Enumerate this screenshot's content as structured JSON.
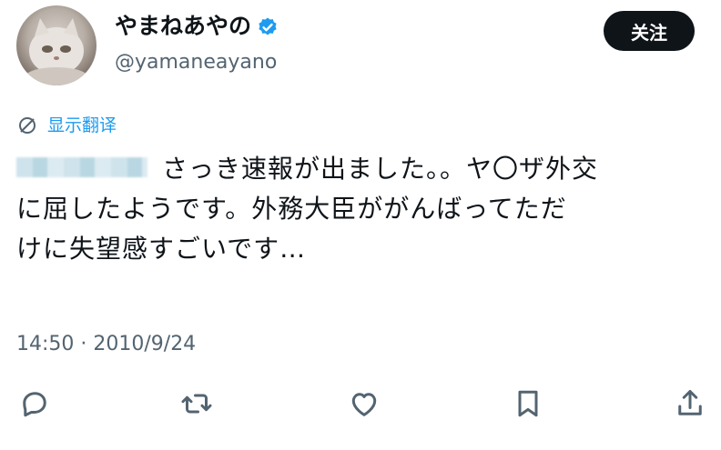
{
  "user": {
    "display_name": "やまねあやの",
    "handle": "@yamaneayano",
    "verified": true
  },
  "header": {
    "follow_label": "关注"
  },
  "translate": {
    "label": "显示翻译",
    "icon": "translate-globe-icon"
  },
  "tweet": {
    "lines": [
      "さっき速報が出ました。。ヤ〇ザ外交",
      "に屈したようです。外務大臣ががんばってただ",
      "けに失望感すごいです…"
    ],
    "timestamp": "14:50 · 2010/9/24"
  },
  "actions": [
    {
      "name": "reply",
      "icon": "reply-icon"
    },
    {
      "name": "retweet",
      "icon": "retweet-icon"
    },
    {
      "name": "like",
      "icon": "heart-icon"
    },
    {
      "name": "bookmark",
      "icon": "bookmark-icon"
    },
    {
      "name": "share",
      "icon": "share-icon"
    }
  ],
  "colors": {
    "accent": "#1d9bf0",
    "text": "#0f1419",
    "secondary": "#536471",
    "button_bg": "#0f1419"
  }
}
